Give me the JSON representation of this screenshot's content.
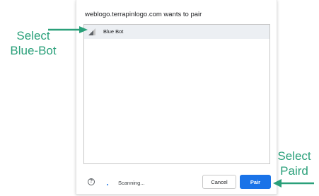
{
  "dialog": {
    "title": "weblogo.terrapinlogo.com wants to pair",
    "devices": [
      {
        "name": "Blue Bot",
        "selected": true,
        "icon": "signal-strength-icon"
      }
    ],
    "help_icon": "question-circle-icon",
    "status": "Scanning...",
    "cancel_label": "Cancel",
    "pair_label": "Pair"
  },
  "annotations": {
    "left_line1": "Select",
    "left_line2": "Blue-Bot",
    "right_line1": "Select",
    "right_line2": "Paird"
  },
  "colors": {
    "annotation": "#2aa07a",
    "primary_button": "#1a73e8",
    "selected_row": "#eceff3"
  }
}
